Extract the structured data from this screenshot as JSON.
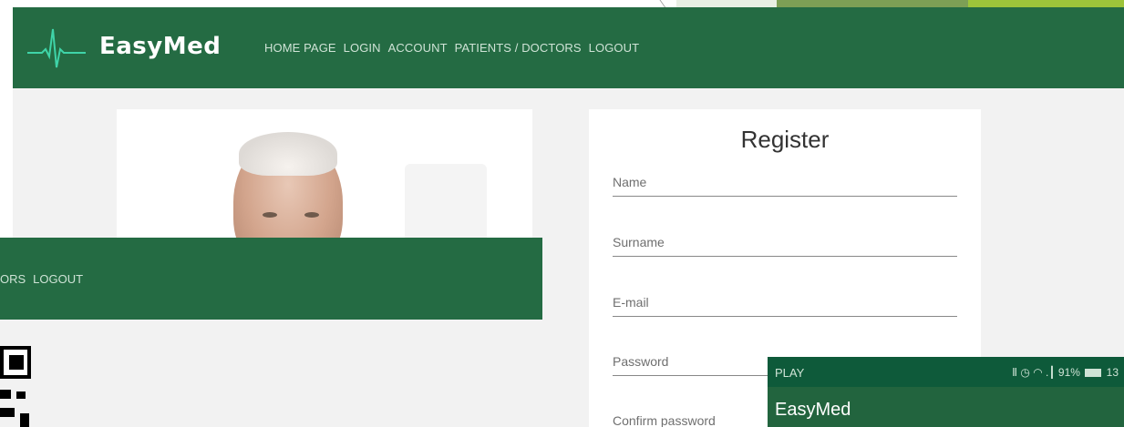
{
  "navbar": {
    "brand": "EasyMed",
    "links": [
      "HOME PAGE",
      "LOGIN",
      "ACCOUNT",
      "PATIENTS / DOCTORS",
      "LOGOUT"
    ]
  },
  "overlay_nav": {
    "links": [
      "ORS",
      "LOGOUT"
    ]
  },
  "register": {
    "title": "Register",
    "fields": [
      "Name",
      "Surname",
      "E-mail",
      "Password",
      "Confirm password"
    ]
  },
  "phone": {
    "status_left": "PLAY",
    "status_right_pre": "Ⅱ ◷ ◠ .┃",
    "battery_percent": "91%",
    "time": "13",
    "app_title": "EasyMed"
  },
  "colors": {
    "nav_green": "#246b43",
    "phone_status": "#0e5a3a",
    "pulse": "#3fd4a8"
  }
}
